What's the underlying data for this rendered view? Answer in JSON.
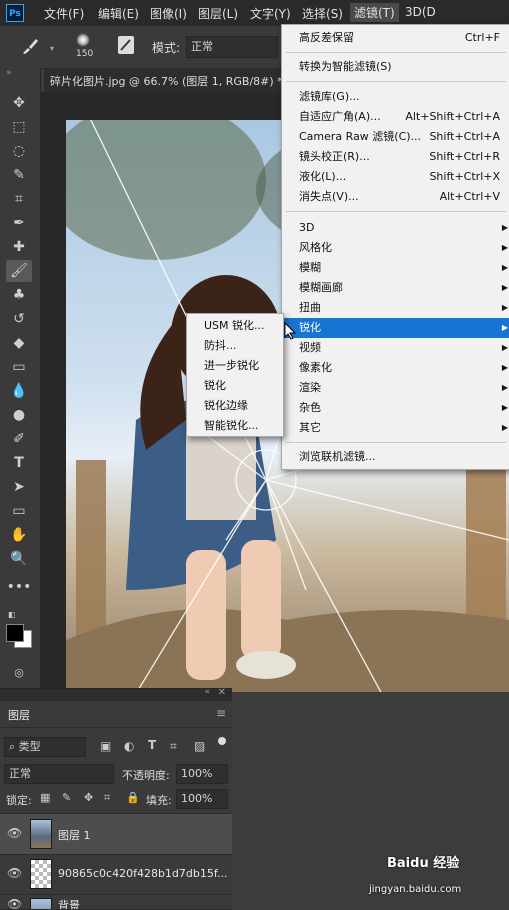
{
  "menubar": {
    "logo": "Ps",
    "items": [
      "文件(F)",
      "编辑(E)",
      "图像(I)",
      "图层(L)",
      "文字(Y)",
      "选择(S)",
      "滤镜(T)",
      "3D(D"
    ]
  },
  "options": {
    "brush_size": "150",
    "mode_label": "模式:",
    "mode_value": "正常"
  },
  "tab": {
    "title": "碎片化图片.jpg @ 66.7% (图层 1, RGB/8#) *"
  },
  "filter_menu": {
    "items": [
      {
        "label": "高反差保留",
        "shortcut": "Ctrl+F"
      },
      {
        "label": "转换为智能滤镜(S)",
        "shortcut": ""
      },
      {
        "label": "滤镜库(G)...",
        "shortcut": ""
      },
      {
        "label": "自适应广角(A)...",
        "shortcut": "Alt+Shift+Ctrl+A"
      },
      {
        "label": "Camera Raw 滤镜(C)...",
        "shortcut": "Shift+Ctrl+A"
      },
      {
        "label": "镜头校正(R)...",
        "shortcut": "Shift+Ctrl+R"
      },
      {
        "label": "液化(L)...",
        "shortcut": "Shift+Ctrl+X"
      },
      {
        "label": "消失点(V)...",
        "shortcut": "Alt+Ctrl+V"
      },
      {
        "label": "3D",
        "shortcut": ""
      },
      {
        "label": "风格化",
        "shortcut": ""
      },
      {
        "label": "模糊",
        "shortcut": ""
      },
      {
        "label": "模糊画廊",
        "shortcut": ""
      },
      {
        "label": "扭曲",
        "shortcut": ""
      },
      {
        "label": "锐化",
        "shortcut": ""
      },
      {
        "label": "视频",
        "shortcut": ""
      },
      {
        "label": "像素化",
        "shortcut": ""
      },
      {
        "label": "渲染",
        "shortcut": ""
      },
      {
        "label": "杂色",
        "shortcut": ""
      },
      {
        "label": "其它",
        "shortcut": ""
      },
      {
        "label": "浏览联机滤镜...",
        "shortcut": ""
      }
    ]
  },
  "sharpen_submenu": {
    "items": [
      "USM 锐化...",
      "防抖...",
      "进一步锐化",
      "锐化",
      "锐化边缘",
      "智能锐化..."
    ]
  },
  "layers_panel": {
    "title": "图层",
    "filter_kind": "类型",
    "blend_mode": "正常",
    "opacity_label": "不透明度:",
    "opacity_value": "100%",
    "lock_label": "锁定:",
    "fill_label": "填充:",
    "fill_value": "100%",
    "layers": [
      {
        "name": "图层 1"
      },
      {
        "name": "90865c0c420f428b1d7db15f..."
      },
      {
        "name": "背景"
      }
    ]
  },
  "watermark": {
    "brand": "Baidu 经验",
    "url": "jingyan.baidu.com"
  }
}
